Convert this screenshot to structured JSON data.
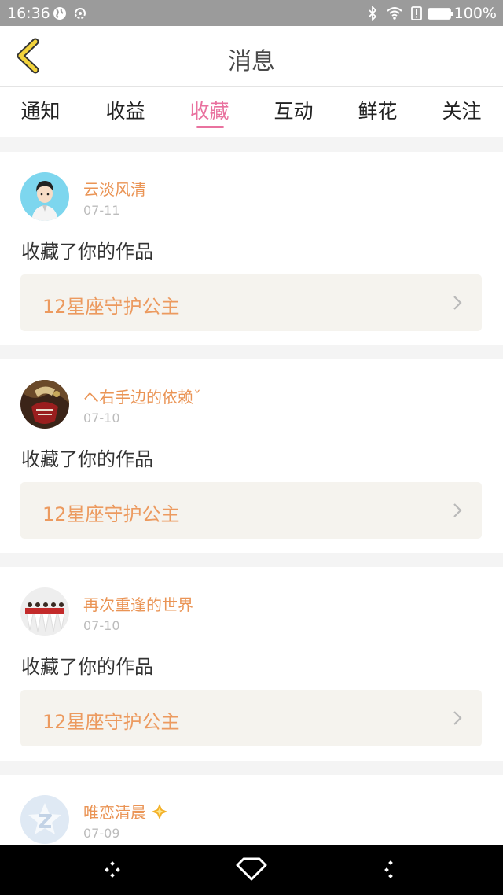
{
  "status_bar": {
    "time": "16:36",
    "battery": "100%"
  },
  "header": {
    "title": "消息"
  },
  "tabs": [
    {
      "label": "通知",
      "active": false
    },
    {
      "label": "收益",
      "active": false
    },
    {
      "label": "收藏",
      "active": true
    },
    {
      "label": "互动",
      "active": false
    },
    {
      "label": "鲜花",
      "active": false
    },
    {
      "label": "关注",
      "active": false
    }
  ],
  "messages": [
    {
      "username": "云淡风清",
      "date": "07-11",
      "action": "收藏了你的作品",
      "work": "12星座守护公主"
    },
    {
      "username": "ヘ右手边的依赖ˇ",
      "date": "07-10",
      "action": "收藏了你的作品",
      "work": "12星座守护公主"
    },
    {
      "username": "再次重逢的世界",
      "date": "07-10",
      "action": "收藏了你的作品",
      "work": "12星座守护公主"
    },
    {
      "username": "唯恋清晨",
      "date": "07-09"
    }
  ],
  "colors": {
    "accent": "#e9729f",
    "username": "#ea9455",
    "work_title": "#ec9a5f",
    "back_icon": "#f2d33c"
  }
}
